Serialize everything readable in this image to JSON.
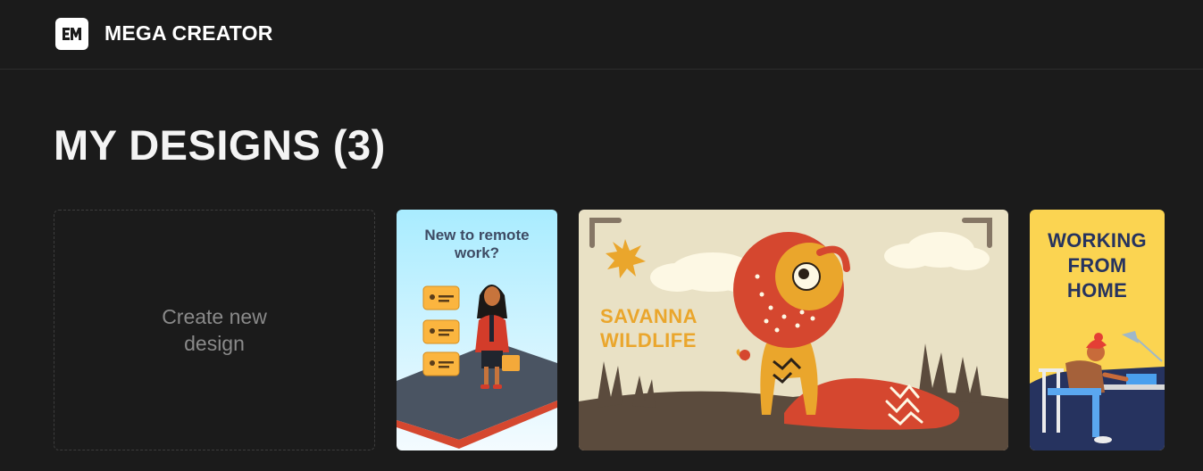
{
  "header": {
    "brand": "MEGA CREATOR",
    "logo_icon": "mega-creator-logo-icon"
  },
  "main": {
    "title": "MY DESIGNS (3)",
    "create_label": "Create new design",
    "designs": [
      {
        "title": "New to remote work?",
        "colors": {
          "sky_top": "#a9ecff",
          "sky_bottom": "#f4fbff"
        }
      },
      {
        "title": "SAVANNA WILDLIFE",
        "colors": {
          "background": "#e9e1c5",
          "text": "#eaa62c"
        }
      },
      {
        "title": "WORKING FROM HOME",
        "colors": {
          "background": "#fbd451",
          "text": "#26335f"
        }
      }
    ]
  },
  "colors": {
    "page_background": "#1b1b1b",
    "header_border": "#2c2c2c",
    "create_border": "#3d3d3d"
  }
}
